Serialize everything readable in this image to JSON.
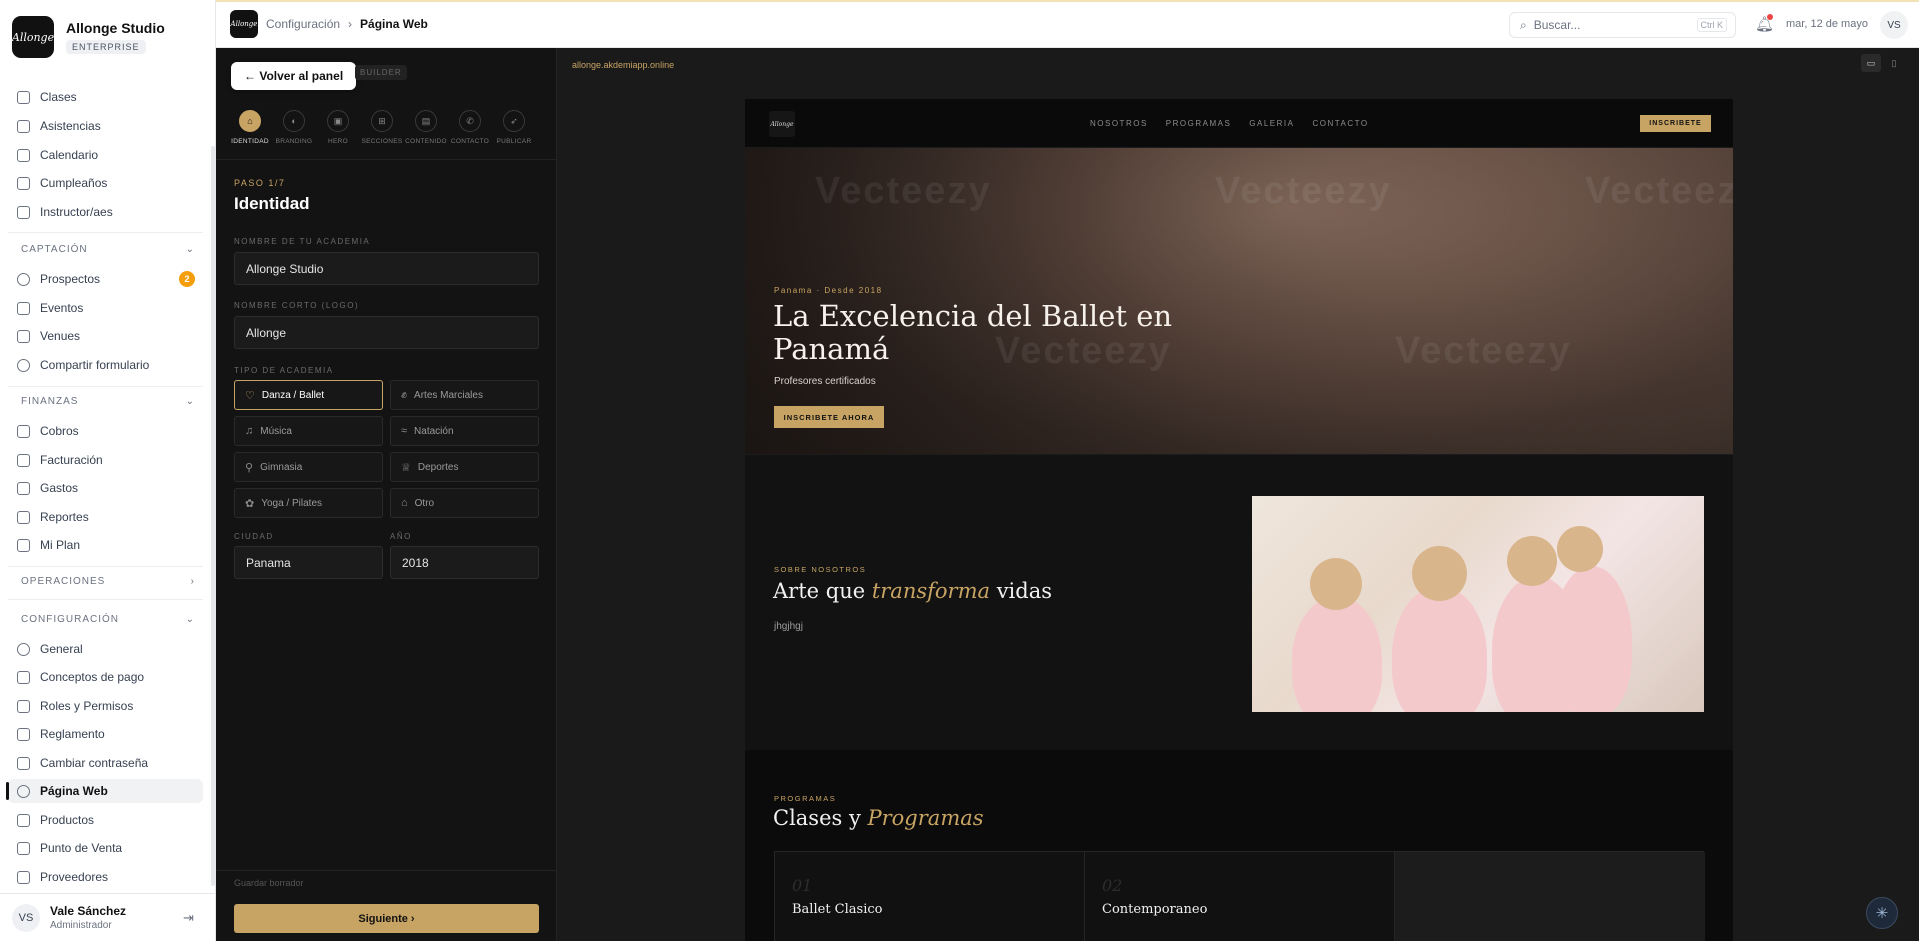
{
  "brand": {
    "logo_text": "Allonge",
    "name": "Allonge Studio",
    "plan": "ENTERPRISE"
  },
  "nav": {
    "items_top": [
      {
        "label": "Clases",
        "icon": "calendar-icon"
      },
      {
        "label": "Asistencias",
        "icon": "check-icon"
      },
      {
        "label": "Calendario",
        "icon": "calendar-icon"
      },
      {
        "label": "Cumpleaños",
        "icon": "cake-icon"
      },
      {
        "label": "Instructor/aes",
        "icon": "graduation-icon"
      }
    ],
    "sec_captacion": "CAPTACIÓN",
    "items_captacion": [
      {
        "label": "Prospectos",
        "icon": "target-icon",
        "badge": "2"
      },
      {
        "label": "Eventos",
        "icon": "calendar-icon"
      },
      {
        "label": "Venues",
        "icon": "building-icon"
      },
      {
        "label": "Compartir formulario",
        "icon": "share-icon"
      }
    ],
    "sec_finanzas": "FINANZAS",
    "items_finanzas": [
      {
        "label": "Cobros",
        "icon": "card-icon"
      },
      {
        "label": "Facturación",
        "icon": "file-icon"
      },
      {
        "label": "Gastos",
        "icon": "receipt-icon"
      },
      {
        "label": "Reportes",
        "icon": "bar-chart-icon"
      },
      {
        "label": "Mi Plan",
        "icon": "document-icon"
      }
    ],
    "sec_operaciones": "OPERACIONES",
    "sec_configuracion": "CONFIGURACIÓN",
    "items_config": [
      {
        "label": "General",
        "icon": "gear-icon"
      },
      {
        "label": "Conceptos de pago",
        "icon": "card-icon"
      },
      {
        "label": "Roles y Permisos",
        "icon": "shield-icon"
      },
      {
        "label": "Reglamento",
        "icon": "document-icon"
      },
      {
        "label": "Cambiar contraseña",
        "icon": "key-icon"
      },
      {
        "label": "Página Web",
        "icon": "globe-icon"
      },
      {
        "label": "Productos",
        "icon": "box-icon"
      },
      {
        "label": "Punto de Venta",
        "icon": "scan-icon"
      },
      {
        "label": "Proveedores",
        "icon": "truck-icon"
      }
    ]
  },
  "user": {
    "initials": "VS",
    "name": "Vale Sánchez",
    "role": "Administrador"
  },
  "topbar": {
    "logo_text": "Allonge",
    "crumb_parent": "Configuración",
    "crumb_current": "Página Web",
    "search_placeholder": "Buscar...",
    "search_shortcut": "Ctrl K",
    "date": "mar, 12 de mayo",
    "avatar": "VS"
  },
  "builder": {
    "back_label": "← Volver al panel",
    "builder_tag": "BUILDER",
    "steps": [
      {
        "label": "IDENTIDAD",
        "icon": "home-icon"
      },
      {
        "label": "BRANDING",
        "icon": "palette-icon"
      },
      {
        "label": "HERO",
        "icon": "image-icon"
      },
      {
        "label": "SECCIONES",
        "icon": "grid-icon"
      },
      {
        "label": "CONTENIDO",
        "icon": "file-icon"
      },
      {
        "label": "CONTACTO",
        "icon": "phone-icon"
      },
      {
        "label": "PUBLICAR",
        "icon": "rocket-icon"
      }
    ],
    "active_step": 0,
    "step_counter": "PASO 1/7",
    "title": "Identidad",
    "name_label": "NOMBRE DE TU ACADEMIA",
    "name_value": "Allonge Studio",
    "short_label": "NOMBRE CORTO (LOGO)",
    "short_value": "Allonge",
    "type_label": "TIPO DE ACADEMIA",
    "types": [
      {
        "label": "Danza / Ballet",
        "icon": "heart-icon",
        "selected": true
      },
      {
        "label": "Artes Marciales",
        "icon": "fist-icon"
      },
      {
        "label": "Música",
        "icon": "music-icon"
      },
      {
        "label": "Natación",
        "icon": "waves-icon"
      },
      {
        "label": "Gimnasia",
        "icon": "dumbbell-icon"
      },
      {
        "label": "Deportes",
        "icon": "trophy-icon"
      },
      {
        "label": "Yoga / Pilates",
        "icon": "flower-icon"
      },
      {
        "label": "Otro",
        "icon": "home-icon"
      }
    ],
    "city_label": "CIUDAD",
    "city_value": "Panama",
    "year_label": "AÑO",
    "year_value": "2018",
    "draft_label": "Guardar borrador",
    "next_label": "Siguiente  ›"
  },
  "preview": {
    "url": "allonge.akdemiapp.online",
    "site": {
      "logo_text": "Allonge",
      "links": [
        "NOSOTROS",
        "PROGRAMAS",
        "GALERIA",
        "CONTACTO"
      ],
      "cta": "INSCRIBETE",
      "hero_watermark": "Vecteezy",
      "hero_kicker": "Panama · Desde 2018",
      "hero_title": "La Excelencia del Ballet en Panamá",
      "hero_sub": "Profesores certificados",
      "hero_btn": "INSCRIBETE AHORA",
      "about_kicker": "SOBRE NOSOTROS",
      "about_title_a": "Arte que ",
      "about_title_em": "transforma",
      "about_title_b": " vidas",
      "about_text": "jhgjhgj",
      "prog_kicker": "PROGRAMAS",
      "prog_title_a": "Clases y ",
      "prog_title_em": "Programas",
      "programs": [
        {
          "num": "01",
          "name": "Ballet Clasico"
        },
        {
          "num": "02",
          "name": "Contemporaneo"
        }
      ]
    }
  },
  "colors": {
    "accent": "#c8a464",
    "dark": "#0d0d0d",
    "badge": "#f59e0b"
  }
}
